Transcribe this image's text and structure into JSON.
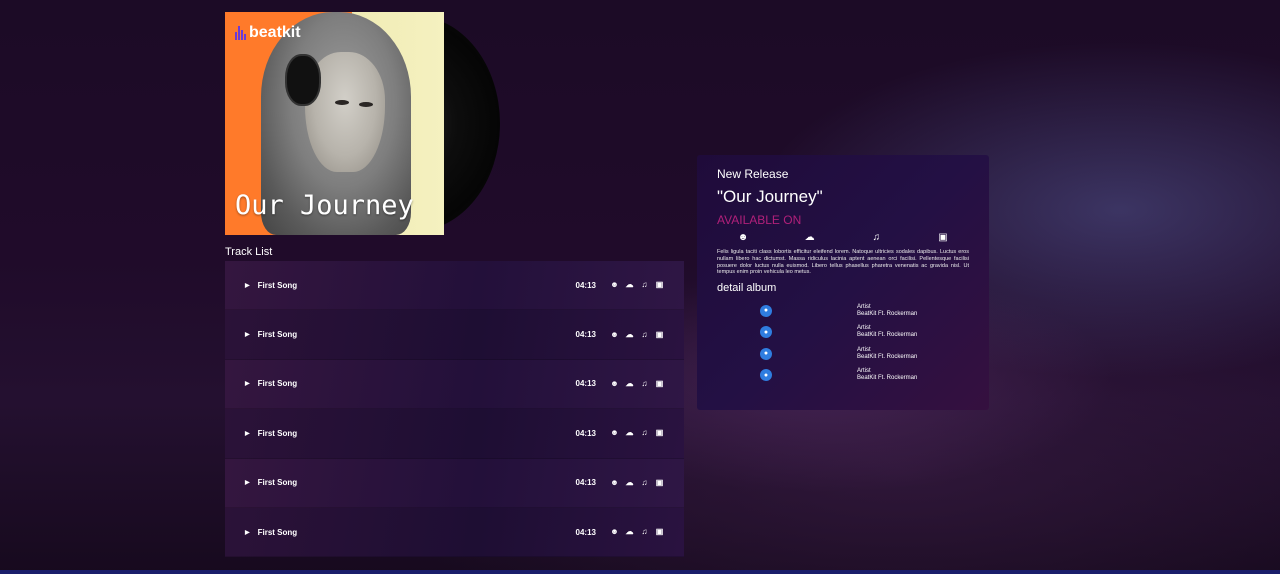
{
  "cover": {
    "logo": "beatkit",
    "title": "Our Journey"
  },
  "tracklist": {
    "title": "Track List",
    "tracks": [
      {
        "name": "First Song",
        "time": "04:13"
      },
      {
        "name": "First Song",
        "time": "04:13"
      },
      {
        "name": "First Song",
        "time": "04:13"
      },
      {
        "name": "First Song",
        "time": "04:13"
      },
      {
        "name": "First Song",
        "time": "04:13"
      },
      {
        "name": "First Song",
        "time": "04:13"
      }
    ],
    "icons": [
      "spotify-icon",
      "soundcloud-icon",
      "music-note-icon",
      "apple-music-icon"
    ]
  },
  "release": {
    "subtitle": "New Release",
    "title": "\"Our Journey\"",
    "available": "AVAILABLE ON",
    "platforms": [
      "spotify-icon",
      "soundcloud-icon",
      "music-note-icon",
      "store-icon"
    ],
    "description": "Felis ligula taciti class lobortis efficitur eleifend lorem. Natoque ultricies sodales dapibus. Luctus eros nullam libero hac dictumst. Massa ridiculus lacinia aptent aenean orci facilisi. Pellentesque facilisi posuere dolor luctus nulla euismod. Libero tellus phasellus pharetra venenatis ac gravida nisl. Ut tempus enim proin vehicula leo metus.",
    "detail_title": "detail album",
    "artists": [
      {
        "label": "Artist",
        "name": "BeatKit Ft. Rockerman"
      },
      {
        "label": "Artist",
        "name": "BeatKit Ft. Rockerman"
      },
      {
        "label": "Artist",
        "name": "BeatKit Ft. Rockerman"
      },
      {
        "label": "Artist",
        "name": "BeatKit Ft. Rockerman"
      }
    ]
  },
  "colors": {
    "accent": "#b1207a",
    "mic": "#2f7de0",
    "cover_orange": "#ff7a2a",
    "cover_cream": "#f5f1c0"
  }
}
